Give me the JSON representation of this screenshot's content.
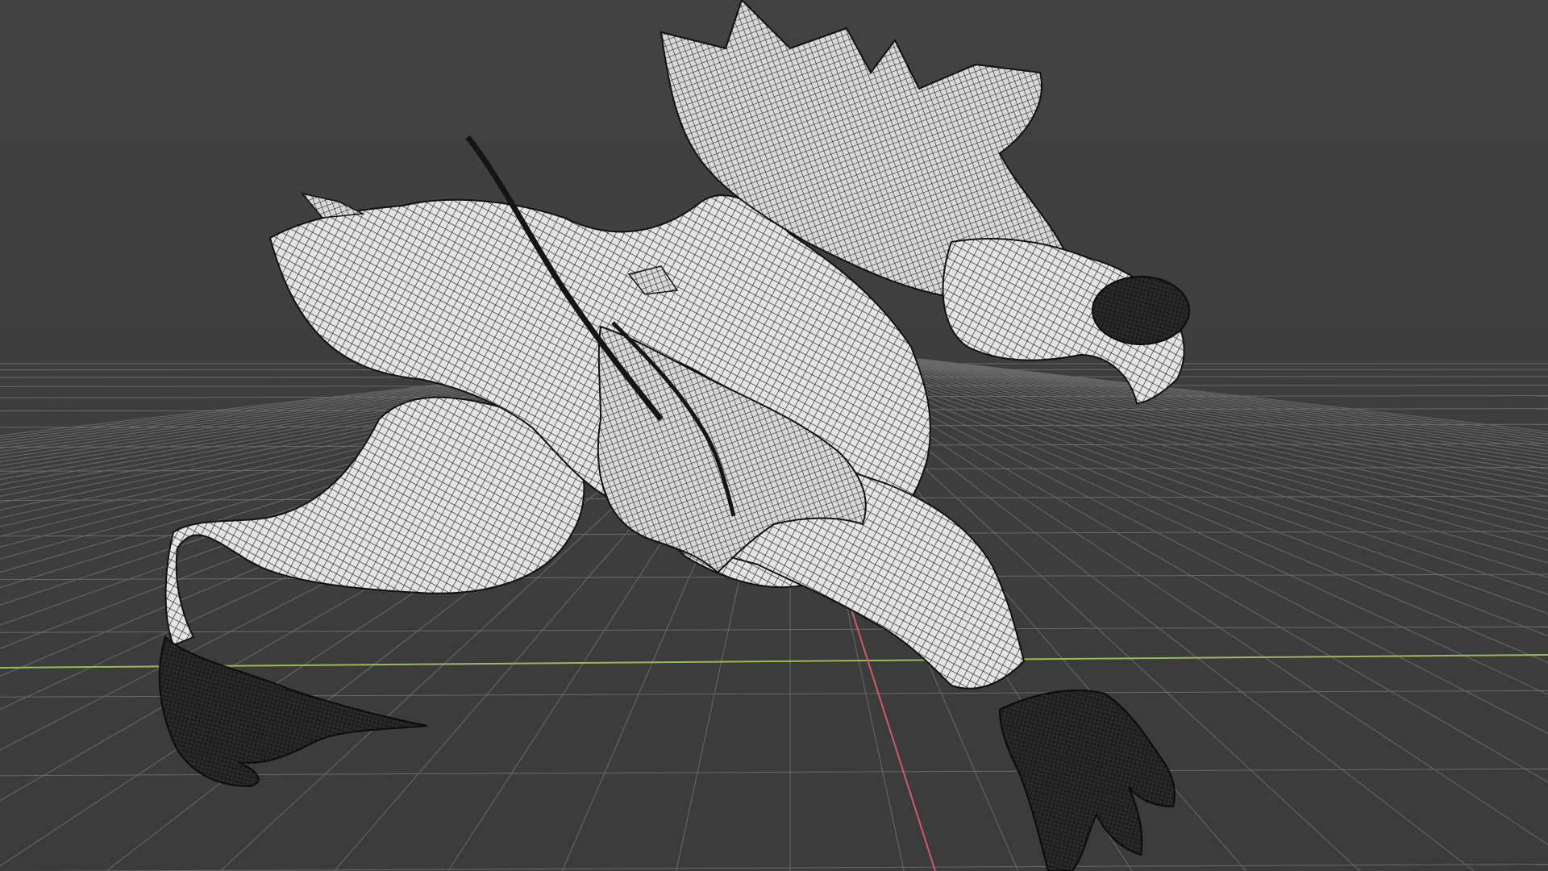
{
  "viewport": {
    "name": "3D viewport",
    "background_color": "#3f3f3f",
    "grid": {
      "visible": true,
      "line_color": "#6a6a6a",
      "x_axis_color": "#9bb85a",
      "y_axis_color": "#d25a6e"
    },
    "scene_object": {
      "name": "creature-mesh",
      "display_mode": "wireframe",
      "surface_color": "#e6e6e6",
      "wire_color": "#141414"
    }
  }
}
